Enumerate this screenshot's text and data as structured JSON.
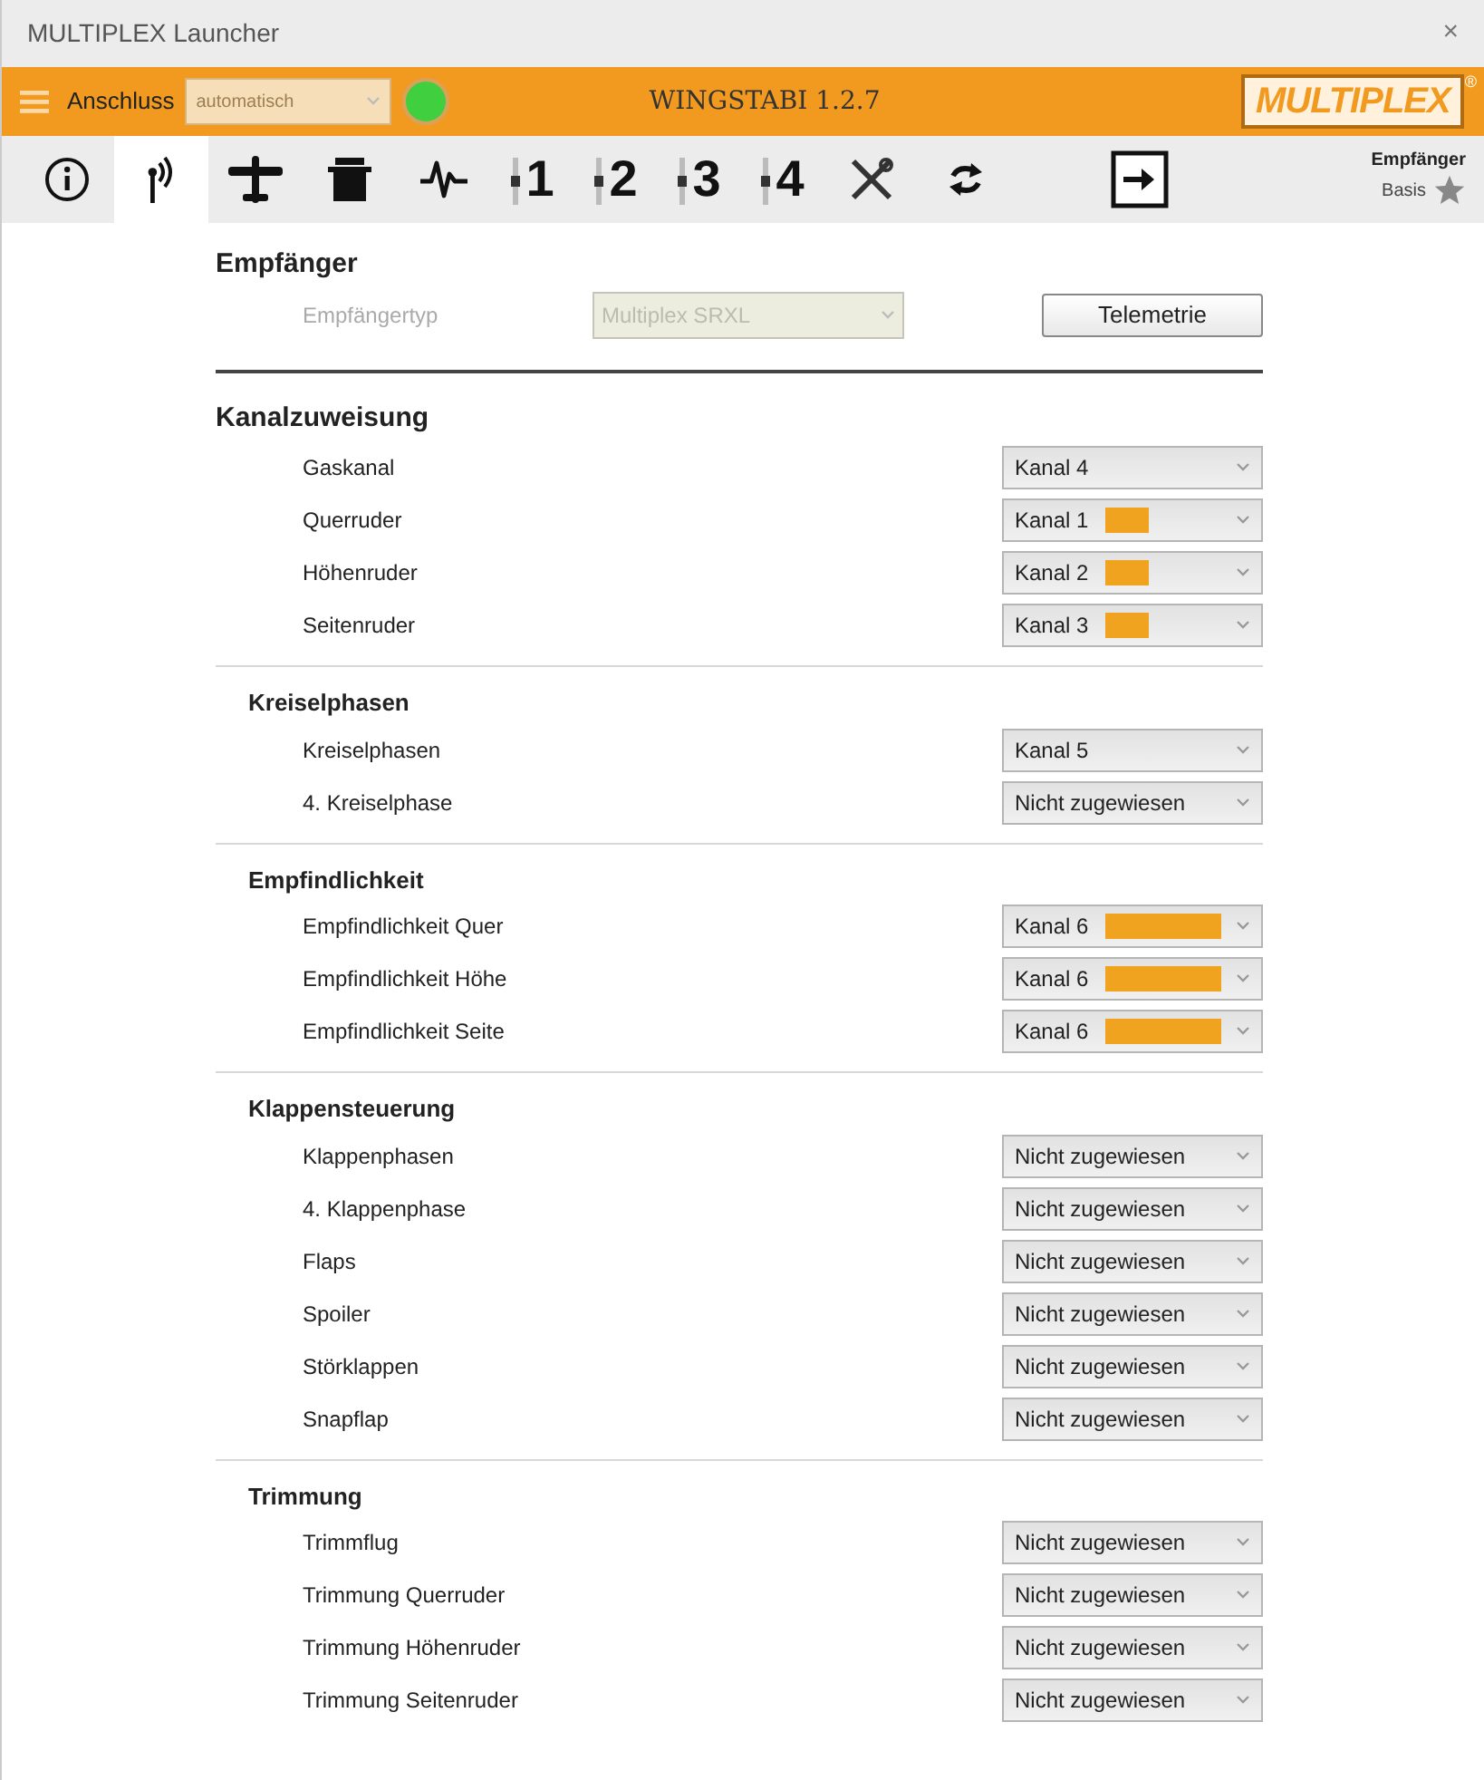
{
  "window": {
    "title": "MULTIPLEX Launcher",
    "close": "×"
  },
  "header": {
    "connection_label": "Anschluss",
    "connection_value": "automatisch",
    "connected": true,
    "device": "WINGSTABI 1.2.7",
    "logo": "MULTIPLEX",
    "logo_mark": "®"
  },
  "tabs": [
    {
      "kind": "info",
      "selected": false
    },
    {
      "kind": "antenna",
      "selected": true
    },
    {
      "kind": "plane",
      "selected": false
    },
    {
      "kind": "servo",
      "selected": false
    },
    {
      "kind": "wave",
      "selected": false
    },
    {
      "kind": "number",
      "label": "1",
      "selected": false
    },
    {
      "kind": "number",
      "label": "2",
      "selected": false
    },
    {
      "kind": "number",
      "label": "3",
      "selected": false
    },
    {
      "kind": "number",
      "label": "4",
      "selected": false
    },
    {
      "kind": "tools",
      "selected": false
    },
    {
      "kind": "sync",
      "selected": false
    },
    {
      "kind": "exit",
      "selected": false
    }
  ],
  "mode": {
    "title": "Empfänger",
    "level_label": "Basis"
  },
  "receiver": {
    "title": "Empfänger",
    "type_label": "Empfängertyp",
    "type_value": "Multiplex SRXL",
    "button": "Telemetrie"
  },
  "sections": [
    {
      "title": "Kanalzuweisung",
      "major": true,
      "rows": [
        {
          "label": "Gaskanal",
          "value": "Kanal 4",
          "kind": "plain"
        },
        {
          "label": "Querruder",
          "value": "Kanal 1",
          "kind": "short-bar"
        },
        {
          "label": "Höhenruder",
          "value": "Kanal 2",
          "kind": "short-bar"
        },
        {
          "label": "Seitenruder",
          "value": "Kanal 3",
          "kind": "short-bar"
        }
      ]
    },
    {
      "title": "Kreiselphasen",
      "major": false,
      "rows": [
        {
          "label": "Kreiselphasen",
          "value": "Kanal 5"
        },
        {
          "label": "4. Kreiselphase",
          "value": "Nicht zugewiesen"
        }
      ]
    },
    {
      "title": "Empfindlichkeit",
      "major": false,
      "rows": [
        {
          "label": "Empfindlichkeit Quer",
          "value": "Kanal 6",
          "kind": "long-bar"
        },
        {
          "label": "Empfindlichkeit Höhe",
          "value": "Kanal 6",
          "kind": "long-bar"
        },
        {
          "label": "Empfindlichkeit Seite",
          "value": "Kanal 6",
          "kind": "long-bar"
        }
      ]
    },
    {
      "title": "Klappensteuerung",
      "major": false,
      "rows": [
        {
          "label": "Klappenphasen",
          "value": "Nicht zugewiesen"
        },
        {
          "label": "4. Klappenphase",
          "value": "Nicht zugewiesen"
        },
        {
          "label": "Flaps",
          "value": "Nicht zugewiesen"
        },
        {
          "label": "Spoiler",
          "value": "Nicht zugewiesen"
        },
        {
          "label": "Störklappen",
          "value": "Nicht zugewiesen"
        },
        {
          "label": "Snapflap",
          "value": "Nicht zugewiesen"
        }
      ]
    },
    {
      "title": "Trimmung",
      "major": false,
      "rows": [
        {
          "label": "Trimmflug",
          "value": "Nicht zugewiesen"
        },
        {
          "label": "Trimmung Querruder",
          "value": "Nicht zugewiesen"
        },
        {
          "label": "Trimmung Höhenruder",
          "value": "Nicht zugewiesen"
        },
        {
          "label": "Trimmung Seitenruder",
          "value": "Nicht zugewiesen"
        }
      ]
    }
  ]
}
